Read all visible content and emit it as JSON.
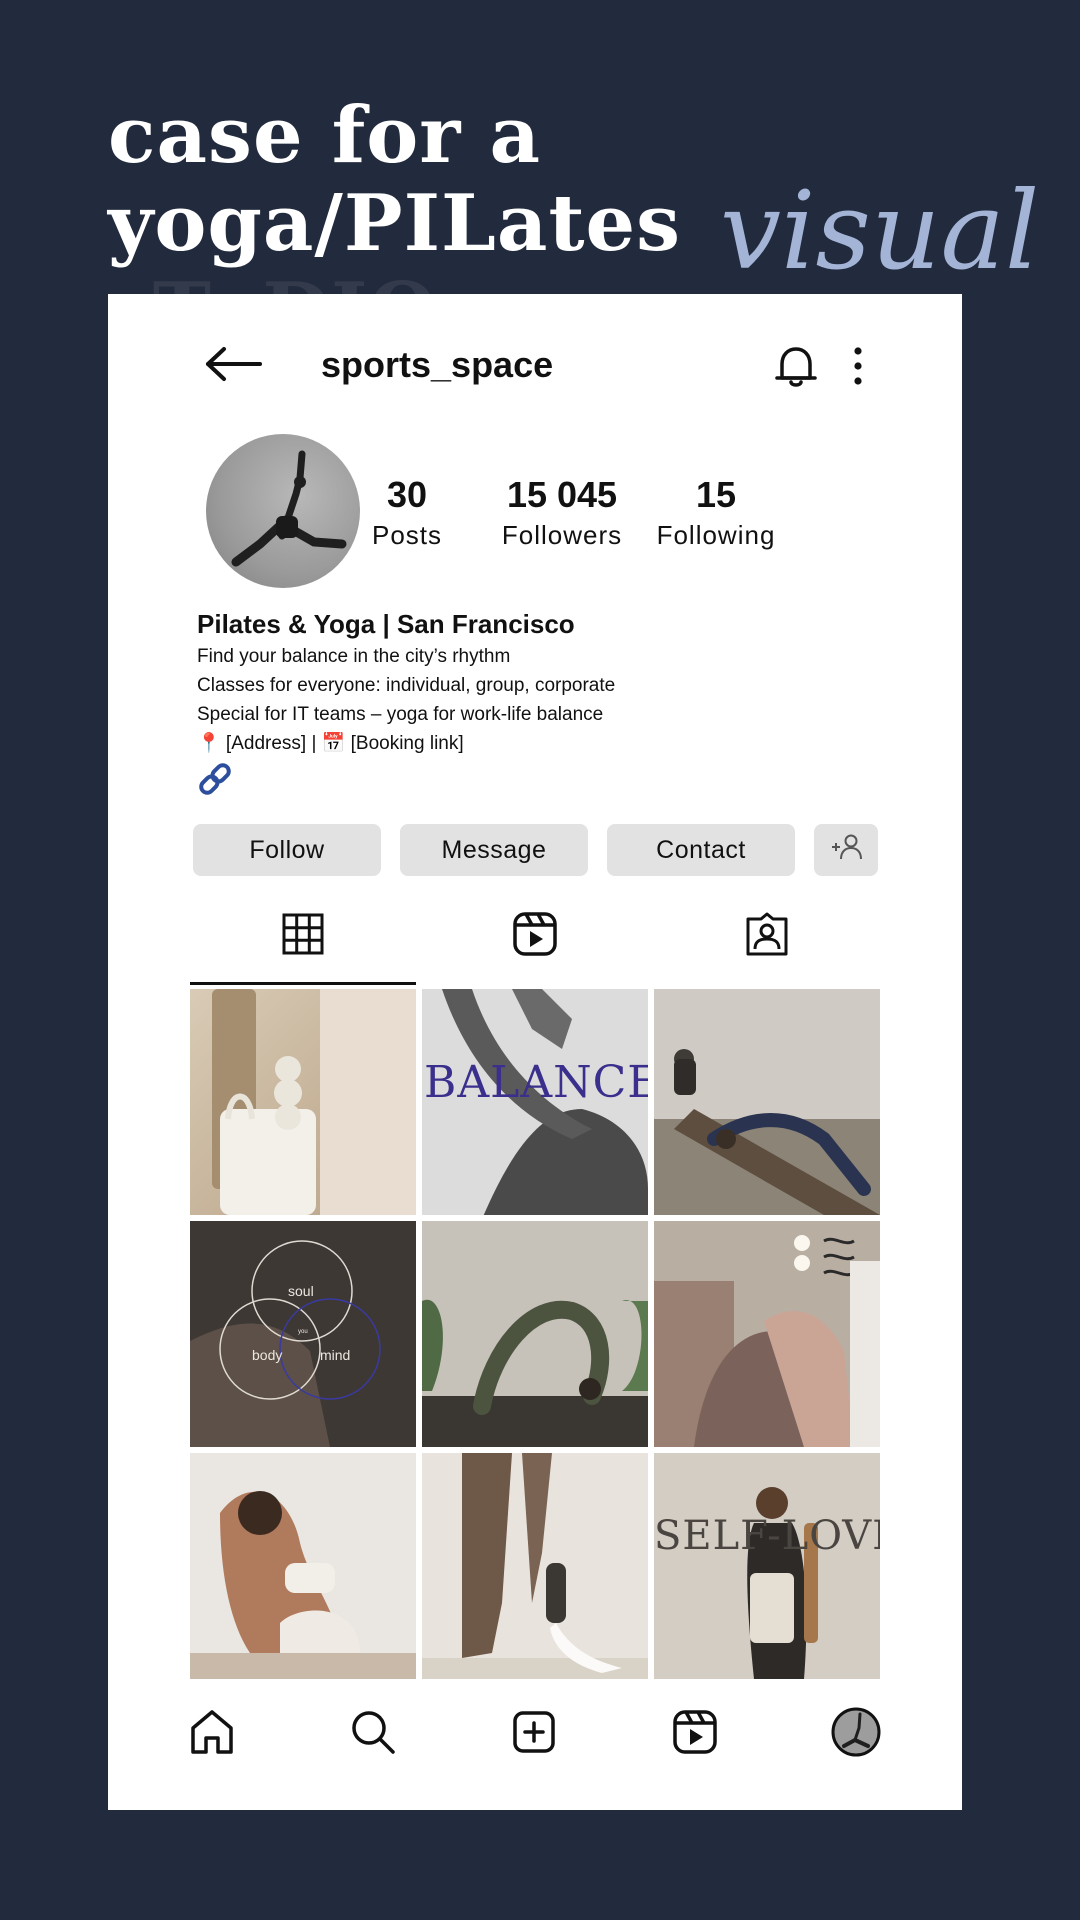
{
  "headline": {
    "line1": "case for a",
    "line2": "yoga/PILates",
    "line3": "sTuDIO",
    "script_word": "visual"
  },
  "profile": {
    "username": "sports_space",
    "stats": [
      {
        "value": "30",
        "label": "Posts"
      },
      {
        "value": "15 045",
        "label": "Followers"
      },
      {
        "value": "15",
        "label": "Following"
      }
    ],
    "bio": {
      "name": "Pilates & Yoga | San Francisco",
      "lines": [
        "Find your balance in the city’s rhythm",
        "Classes for everyone: individual, group, corporate",
        "Special for IT teams – yoga for work-life balance",
        "📍 [Address] | 📅 [Booking link]"
      ]
    },
    "buttons": {
      "follow": "Follow",
      "message": "Message",
      "contact": "Contact"
    }
  },
  "grid": {
    "balance_text": "BALANCE",
    "venn": {
      "top": "soul",
      "left": "body",
      "right": "mind",
      "center": "you"
    },
    "selflove_text": "SELF-LOVE"
  },
  "icons": {
    "back": "arrow-left-icon",
    "bell": "bell-icon",
    "more": "more-vertical-icon",
    "link": "link-icon",
    "add_person": "add-person-icon",
    "grid": "grid-icon",
    "reels": "reels-icon",
    "tagged": "tagged-icon",
    "home": "home-icon",
    "search": "search-icon",
    "create": "create-icon",
    "profile": "profile-avatar-icon"
  },
  "colors": {
    "background": "#222a3d",
    "script_accent": "#a3b4d6",
    "button_bg": "#e2e2e2",
    "link_blue": "#2c4e9c",
    "balance_purple": "#3a2f8c"
  }
}
